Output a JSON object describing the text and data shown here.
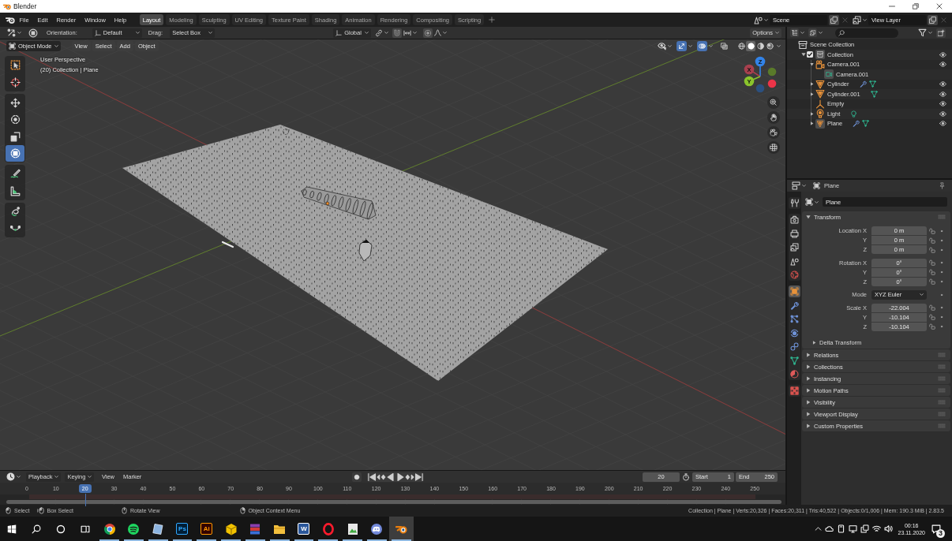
{
  "window": {
    "title": "Blender"
  },
  "menu_bar": {
    "menus": [
      "File",
      "Edit",
      "Render",
      "Window",
      "Help"
    ],
    "workspaces": [
      {
        "label": "Layout",
        "selected": true
      },
      {
        "label": "Modeling",
        "selected": false
      },
      {
        "label": "Sculpting",
        "selected": false
      },
      {
        "label": "UV Editing",
        "selected": false
      },
      {
        "label": "Texture Paint",
        "selected": false
      },
      {
        "label": "Shading",
        "selected": false
      },
      {
        "label": "Animation",
        "selected": false
      },
      {
        "label": "Rendering",
        "selected": false
      },
      {
        "label": "Compositing",
        "selected": false
      },
      {
        "label": "Scripting",
        "selected": false
      }
    ],
    "scene": "Scene",
    "view_layer": "View Layer"
  },
  "tool_settings": {
    "orientation_label": "Orientation:",
    "orientation": "Default",
    "drag_label": "Drag:",
    "drag": "Select Box",
    "transform_orientation": "Global",
    "options": "Options"
  },
  "viewport_header": {
    "mode": "Object Mode",
    "menus": [
      "View",
      "Select",
      "Add",
      "Object"
    ],
    "gizmos": true,
    "overlays": true,
    "xray": false,
    "shading": [
      {
        "kind": "wireframe",
        "selected": false
      },
      {
        "kind": "solid",
        "selected": true
      },
      {
        "kind": "material",
        "selected": false
      },
      {
        "kind": "rendered",
        "selected": false
      }
    ]
  },
  "tool_groups": [
    [
      {
        "kind": "select_box",
        "selected": false
      },
      {
        "kind": "cursor",
        "selected": false
      }
    ],
    [
      {
        "kind": "move",
        "selected": false
      },
      {
        "kind": "rotate",
        "selected": false
      },
      {
        "kind": "scale",
        "selected": false
      },
      {
        "kind": "transform",
        "selected": true
      }
    ],
    [
      {
        "kind": "annotate",
        "selected": false
      },
      {
        "kind": "measure",
        "selected": false
      }
    ],
    [
      {
        "kind": "loop_curve",
        "selected": false
      },
      {
        "kind": "arc_curve",
        "selected": false
      }
    ]
  ],
  "viewport": {
    "view_name": "User Perspective",
    "context": "(20) Collection | Plane",
    "gizmo_axes": [
      {
        "label": "Z",
        "color": "#3283e8"
      },
      {
        "label": "X",
        "color": "#a8404e"
      },
      {
        "label": "Y",
        "color": "#8ac42c"
      }
    ]
  },
  "outliner": {
    "tree": [
      {
        "label": "Scene Collection",
        "kind": "scene_collection",
        "active": false,
        "children": [
          {
            "label": "Collection",
            "kind": "collection",
            "expanded": true,
            "checked": true,
            "active": true,
            "visible": true,
            "children": [
              {
                "label": "Camera.001",
                "kind": "camera",
                "expanded": true,
                "active": false,
                "visible": true,
                "children": [
                  {
                    "label": "Camera.001",
                    "kind": "camera_data",
                    "active": true
                  }
                ]
              },
              {
                "label": "Cylinder",
                "kind": "mesh",
                "expanded": false,
                "active": false,
                "visible": true,
                "data_icons": [
                  {
                    "kind": "modifier"
                  },
                  {
                    "kind": "mesh_data"
                  }
                ]
              },
              {
                "label": "Cylinder.001",
                "kind": "mesh",
                "expanded": false,
                "active": false,
                "visible": true,
                "data_icons": [
                  {
                    "kind": "mesh_data"
                  }
                ]
              },
              {
                "label": "Empty",
                "kind": "empty",
                "active": false,
                "visible": true
              },
              {
                "label": "Light",
                "kind": "light",
                "expanded": false,
                "active": false,
                "visible": true,
                "data_icons": [
                  {
                    "kind": "light_data"
                  }
                ]
              },
              {
                "label": "Plane",
                "kind": "mesh",
                "expanded": false,
                "active": true,
                "visible": true,
                "data_icons": [
                  {
                    "kind": "modifier"
                  },
                  {
                    "kind": "mesh_data"
                  }
                ]
              }
            ]
          }
        ]
      }
    ]
  },
  "properties": {
    "object": "Plane",
    "tab_groups": [
      [
        {
          "kind": "tool",
          "selected": false
        }
      ],
      [
        {
          "kind": "render",
          "selected": false
        },
        {
          "kind": "output",
          "selected": false
        },
        {
          "kind": "view_layer",
          "selected": false
        },
        {
          "kind": "scene",
          "selected": false
        },
        {
          "kind": "world",
          "selected": false
        }
      ],
      [
        {
          "kind": "object",
          "selected": true
        },
        {
          "kind": "modifiers",
          "selected": false
        },
        {
          "kind": "particles",
          "selected": false
        },
        {
          "kind": "physics",
          "selected": false
        },
        {
          "kind": "constraints",
          "selected": false
        },
        {
          "kind": "data",
          "selected": false
        },
        {
          "kind": "material",
          "selected": false
        }
      ],
      [
        {
          "kind": "texture",
          "selected": false
        }
      ]
    ],
    "data_block": "Plane",
    "transform": {
      "title": "Transform",
      "expanded": true,
      "groups": [
        {
          "kind": "vector",
          "rows": [
            {
              "label": "Location X",
              "value": "0 m",
              "locked": false
            },
            {
              "label": "Y",
              "value": "0 m",
              "locked": false
            },
            {
              "label": "Z",
              "value": "0 m",
              "locked": false
            }
          ]
        },
        {
          "kind": "vector",
          "rows": [
            {
              "label": "Rotation X",
              "value": "0°",
              "locked": false
            },
            {
              "label": "Y",
              "value": "0°",
              "locked": false
            },
            {
              "label": "Z",
              "value": "0°",
              "locked": false
            }
          ]
        },
        {
          "kind": "dropdown",
          "label": "Mode",
          "value": "XYZ Euler"
        },
        {
          "kind": "vector",
          "rows": [
            {
              "label": "Scale X",
              "value": "-22.004",
              "locked": false
            },
            {
              "label": "Y",
              "value": "-10.104",
              "locked": false
            },
            {
              "label": "Z",
              "value": "-10.104",
              "locked": false
            }
          ]
        }
      ],
      "subpanels": [
        {
          "title": "Delta Transform",
          "expanded": false
        }
      ]
    },
    "panels": [
      {
        "title": "Relations",
        "expanded": false
      },
      {
        "title": "Collections",
        "expanded": false
      },
      {
        "title": "Instancing",
        "expanded": false
      },
      {
        "title": "Motion Paths",
        "expanded": false
      },
      {
        "title": "Visibility",
        "expanded": false
      },
      {
        "title": "Viewport Display",
        "expanded": false
      },
      {
        "title": "Custom Properties",
        "expanded": false
      }
    ]
  },
  "timeline": {
    "menus": [
      {
        "label": "Playback",
        "kind": "dropdown"
      },
      {
        "label": "Keying",
        "kind": "dropdown"
      },
      {
        "label": "View",
        "kind": "menu"
      },
      {
        "label": "Marker",
        "kind": "menu"
      }
    ],
    "current_frame": "20",
    "start_label": "Start",
    "start": "1",
    "end_label": "End",
    "end": "250",
    "ruler": [
      {
        "label": "0",
        "selected": false
      },
      {
        "label": "10",
        "selected": false
      },
      {
        "label": "20",
        "selected": true
      },
      {
        "label": "30",
        "selected": false
      },
      {
        "label": "40",
        "selected": false
      },
      {
        "label": "50",
        "selected": false
      },
      {
        "label": "60",
        "selected": false
      },
      {
        "label": "70",
        "selected": false
      },
      {
        "label": "80",
        "selected": false
      },
      {
        "label": "90",
        "selected": false
      },
      {
        "label": "100",
        "selected": false
      },
      {
        "label": "110",
        "selected": false
      },
      {
        "label": "120",
        "selected": false
      },
      {
        "label": "130",
        "selected": false
      },
      {
        "label": "140",
        "selected": false
      },
      {
        "label": "150",
        "selected": false
      },
      {
        "label": "160",
        "selected": false
      },
      {
        "label": "170",
        "selected": false
      },
      {
        "label": "180",
        "selected": false
      },
      {
        "label": "190",
        "selected": false
      },
      {
        "label": "200",
        "selected": false
      },
      {
        "label": "210",
        "selected": false
      },
      {
        "label": "220",
        "selected": false
      },
      {
        "label": "230",
        "selected": false
      },
      {
        "label": "240",
        "selected": false
      },
      {
        "label": "250",
        "selected": false
      }
    ]
  },
  "status_bar": {
    "hints": [
      {
        "label": "Select",
        "kind": "left_click"
      },
      {
        "label": "Box Select",
        "kind": "left_drag"
      },
      {
        "label": "Rotate View",
        "kind": "middle_click"
      },
      {
        "label": "Object Context Menu",
        "kind": "right_click"
      }
    ],
    "stats": "Collection | Plane | Verts:20,326 | Faces:20,311 | Tris:40,522 | Objects:0/1,006 | Mem: 190.3 MiB | 2.83.5"
  },
  "taskbar": {
    "apps": [
      {
        "kind": "ring_logo",
        "running": true,
        "selected": false
      },
      {
        "kind": "wave_circle",
        "running": true,
        "selected": false
      },
      {
        "kind": "tilted_page",
        "running": true,
        "selected": false
      },
      {
        "kind": "ps_tile",
        "label": "Ps",
        "running": true,
        "selected": false
      },
      {
        "kind": "ai_tile",
        "label": "Ai",
        "running": true,
        "selected": false
      },
      {
        "kind": "cube",
        "running": true,
        "selected": false
      },
      {
        "kind": "books",
        "running": true,
        "selected": false
      },
      {
        "kind": "folder",
        "running": true,
        "selected": false
      },
      {
        "kind": "word_tile",
        "label": "W",
        "running": true,
        "selected": false
      },
      {
        "kind": "oval_ring",
        "running": true,
        "selected": false
      },
      {
        "kind": "picture_page",
        "running": true,
        "selected": false
      },
      {
        "kind": "round_badge",
        "running": true,
        "selected": false
      },
      {
        "kind": "app_logo",
        "running": true,
        "selected": true
      }
    ],
    "time": "00:16",
    "date": "23.11.2020",
    "notifications": "3"
  }
}
